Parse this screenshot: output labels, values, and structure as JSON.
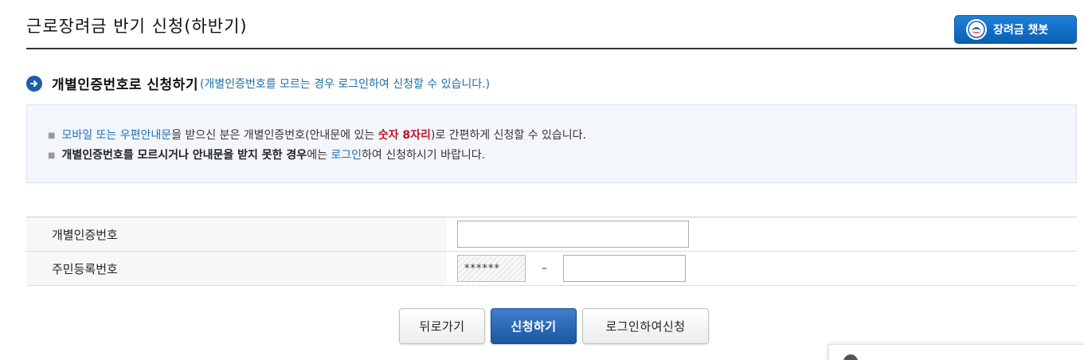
{
  "header": {
    "title": "근로장려금 반기 신청(하반기)",
    "chatbot_label": "장려금 챗봇"
  },
  "section": {
    "title": "개별인증번호로 신청하기",
    "note": "(개별인증번호를 모르는 경우 로그인하여 신청할 수 있습니다.)"
  },
  "info": {
    "line1": {
      "part1": "모바일 또는 우편안내문",
      "part2": "을 받으신 분은 개별인증번호(안내문에 있는 ",
      "part3": "숫자 8자리",
      "part4": ")로 간편하게 신청할 수 있습니다."
    },
    "line2": {
      "part1": "개별인증번호를 모르시거나 안내문을 받지 못한 경우",
      "part2": "에는 ",
      "part3": "로그인",
      "part4": "하여 신청하시기 바랍니다."
    }
  },
  "form": {
    "auth_label": "개별인증번호",
    "auth_value": "",
    "rrn_label": "주민등록번호",
    "rrn_front_masked": "******",
    "rrn_separator": "–",
    "rrn_back_value": ""
  },
  "buttons": {
    "back": "뒤로가기",
    "apply": "신청하기",
    "login_apply": "로그인하여신청"
  },
  "colors": {
    "primary": "#1b57a3",
    "link": "#1d6fb8",
    "highlight": "#c0122b"
  }
}
